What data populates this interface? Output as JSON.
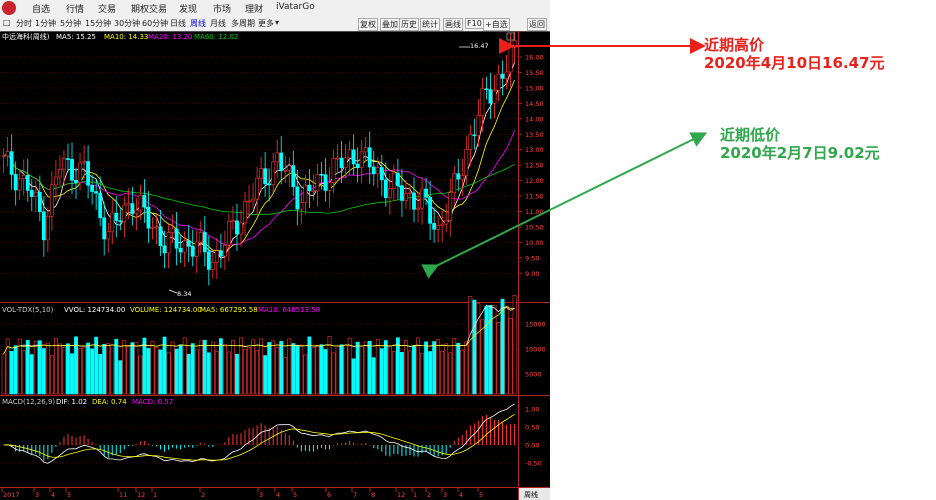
{
  "menubar": {
    "items": [
      "自选",
      "行情",
      "交易",
      "期权交易",
      "发现",
      "市场",
      "理财",
      "iVatarGo"
    ]
  },
  "toolbar": {
    "periods": [
      "分时",
      "1分钟",
      "5分钟",
      "15分钟",
      "30分钟",
      "60分钟",
      "日线",
      "周线",
      "月线",
      "多周期",
      "更多"
    ],
    "active_period": "周线",
    "right_buttons": [
      "复权",
      "叠加",
      "历史",
      "统计",
      "画线",
      "F10",
      "+自选",
      "返回"
    ]
  },
  "price_panel": {
    "stock_name": "中远海科(周线)",
    "ma5": "MA5: 15.25",
    "ma10": "MA10: 14.33",
    "ma20": "MA20: 13.20",
    "ma60": "MA60: 12.02",
    "high_marker": "16.47",
    "low_marker": "8.34",
    "y_ticks": [
      "16.00",
      "15.50",
      "15.00",
      "14.50",
      "14.00",
      "13.50",
      "13.00",
      "12.50",
      "12.00",
      "11.50",
      "11.00",
      "10.50",
      "10.00",
      "9.50",
      "9.00"
    ]
  },
  "volume_panel": {
    "header": "VOL-TDX(5,10)",
    "vvol": "VVOL: 124734.00",
    "volume": "VOLUME: 124734.00",
    "ma5": "MA5: 667295.58",
    "ma10": "MA10: 648513.58",
    "y_ticks": [
      "15000",
      "10000",
      "5000"
    ]
  },
  "macd_panel": {
    "header": "MACD(12,26,9)",
    "dif": "DIF: 1.02",
    "dea": "DEA: 0.74",
    "macd": "MACD: 0.57",
    "y_ticks": [
      "1.00",
      "0.50",
      "0.00",
      "-0.50"
    ]
  },
  "x_axis": {
    "labels": [
      "2017",
      "3",
      "4",
      "5",
      "11",
      "12",
      "1",
      "2",
      "3",
      "4",
      "5",
      "6",
      "7",
      "8",
      "12",
      "1",
      "2",
      "3",
      "4",
      "5"
    ],
    "corner": "周线"
  },
  "annotations": {
    "high": {
      "line1": "近期高价",
      "line2": "2020年4月10日16.47元"
    },
    "low": {
      "line1": "近期低价",
      "line2": "2020年2月7日9.02元"
    }
  },
  "colors": {
    "up": "#ff3232",
    "down": "#00ffff",
    "ma5": "#ffffff",
    "ma10": "#ffff00",
    "ma20": "#ff00ff",
    "ma60": "#00cc00",
    "grid": "#8b0000",
    "annotation_red": "#e8221b",
    "annotation_green": "#2ea84a"
  }
}
